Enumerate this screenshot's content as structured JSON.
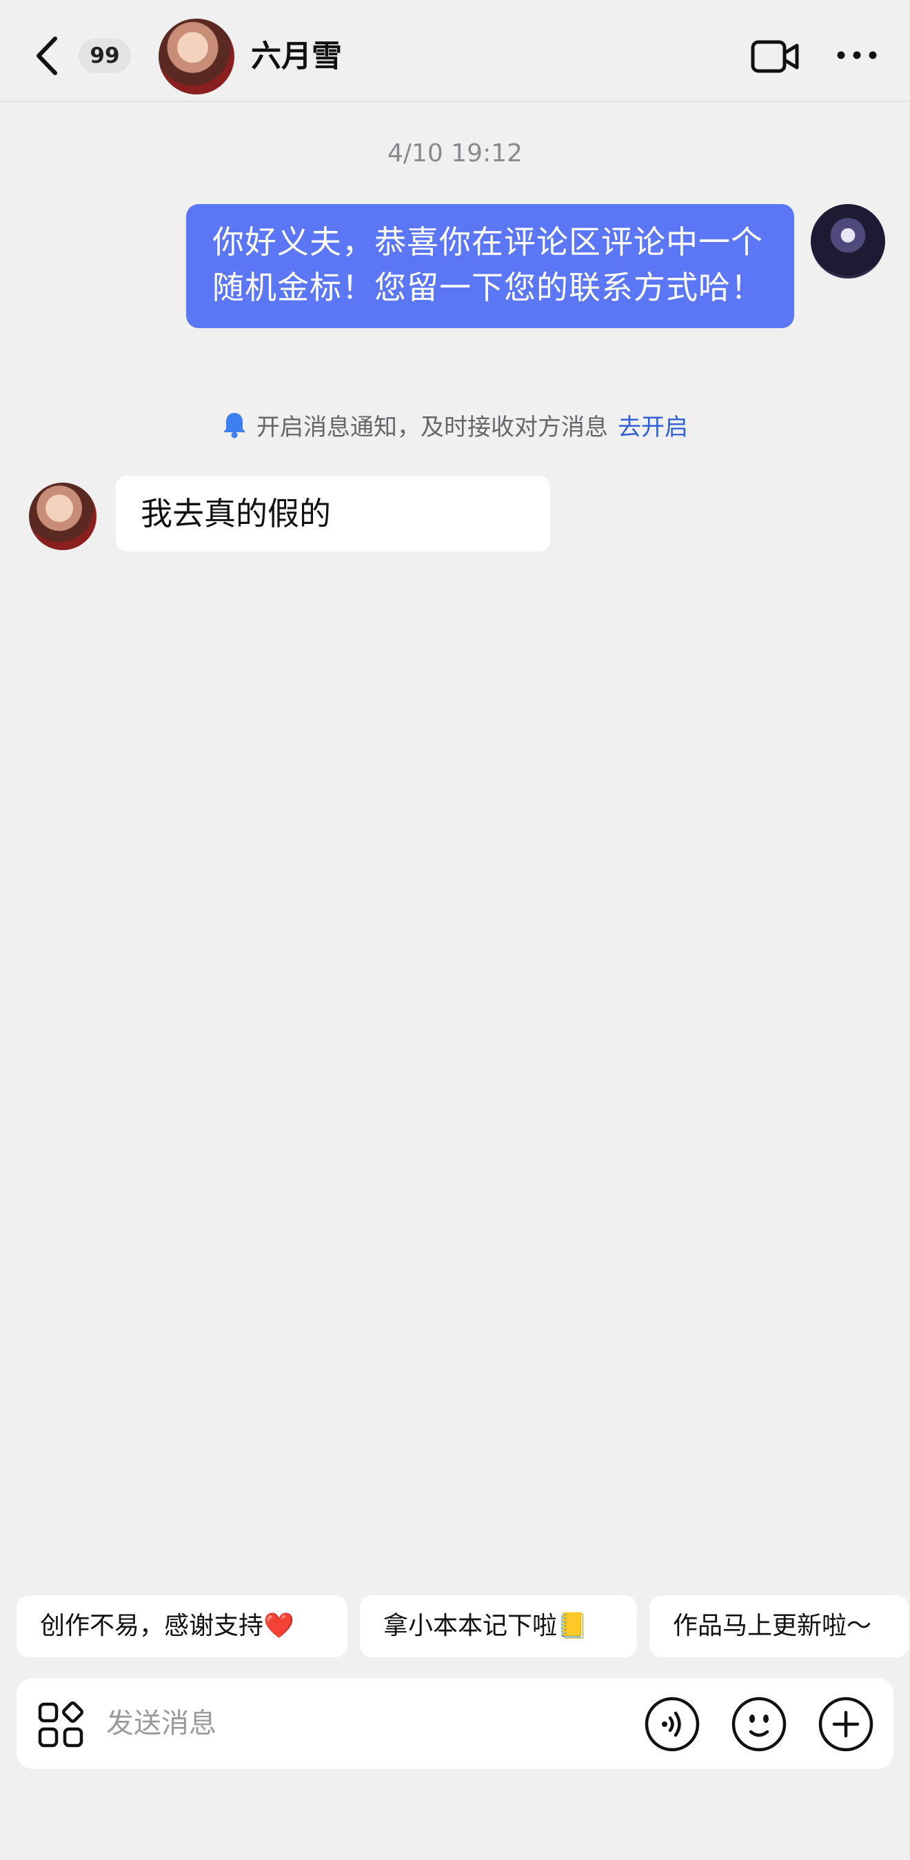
{
  "header": {
    "unread_count": "99",
    "contact_name": "六月雪"
  },
  "timestamp": "4/10 19:12",
  "messages": {
    "outgoing_text": "你好义夫，恭喜你在评论区评论中一个随机金标！您留一下您的联系方式哈！",
    "incoming_text": "我去真的假的"
  },
  "notification": {
    "text": "开启消息通知，及时接收对方消息",
    "link": "去开启",
    "accent": "#2f5fd6"
  },
  "quick_replies": [
    "创作不易，感谢支持❤️",
    "拿小本本记下啦📒",
    "作品马上更新啦～"
  ],
  "composer": {
    "placeholder": "发送消息"
  },
  "colors": {
    "bubble_out": "#5b77f5",
    "background": "#f0f0f1"
  },
  "icons": [
    "chevron-left-icon",
    "video-camera-icon",
    "more-dots-icon",
    "bell-icon",
    "apps-grid-icon",
    "voice-icon",
    "emoji-icon",
    "plus-icon"
  ]
}
